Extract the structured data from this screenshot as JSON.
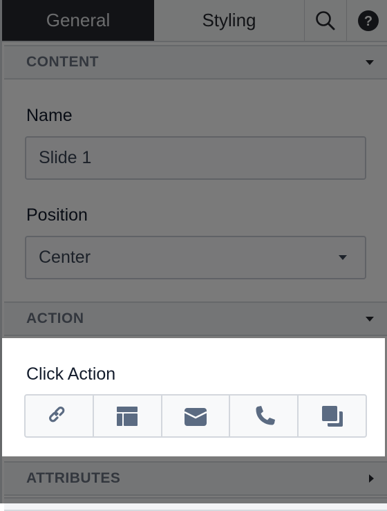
{
  "tabs": [
    {
      "label": "General",
      "active": true
    },
    {
      "label": "Styling",
      "active": false
    }
  ],
  "tab_icons": [
    "search-icon",
    "help-icon"
  ],
  "sections": {
    "content": {
      "title": "CONTENT",
      "expanded": true,
      "fields": {
        "name": {
          "label": "Name",
          "value": "Slide 1"
        },
        "position": {
          "label": "Position",
          "value": "Center"
        }
      }
    },
    "action": {
      "title": "ACTION",
      "expanded": true,
      "click_action": {
        "label": "Click Action",
        "options": [
          "link-icon",
          "layout-icon",
          "envelope-icon",
          "phone-icon",
          "clone-icon"
        ]
      }
    },
    "attributes": {
      "title": "ATTRIBUTES",
      "expanded": false
    }
  },
  "colors": {
    "active_tab_bg": "#26292f",
    "icon": "#5b6b82",
    "overlay": "rgba(0,0,0,0.52)"
  }
}
